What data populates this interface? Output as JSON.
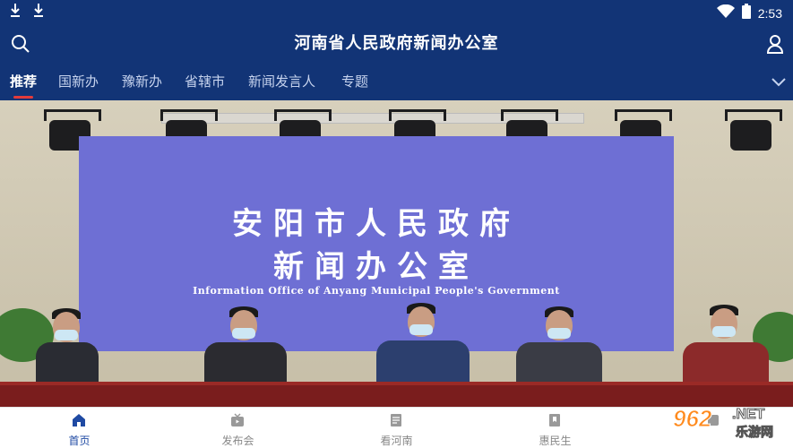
{
  "status_bar": {
    "time": "2:53",
    "icons": [
      "download-icon",
      "download-icon",
      "wifi-icon",
      "battery-icon"
    ]
  },
  "header": {
    "title": "河南省人民政府新闻办公室",
    "left_icon": "search-icon",
    "right_icon": "user-icon"
  },
  "tabs": [
    {
      "label": "推荐",
      "active": true
    },
    {
      "label": "国新办",
      "active": false
    },
    {
      "label": "豫新办",
      "active": false
    },
    {
      "label": "省辖市",
      "active": false
    },
    {
      "label": "新闻发言人",
      "active": false
    },
    {
      "label": "专题",
      "active": false
    }
  ],
  "hero": {
    "backdrop_line1": "安阳市人民政府",
    "backdrop_line2": "新闻办公室",
    "backdrop_en": "Information Office of Anyang Municipal People's Government"
  },
  "bottom_nav": [
    {
      "label": "首页",
      "icon": "home-icon",
      "active": true
    },
    {
      "label": "发布会",
      "icon": "tv-icon",
      "active": false
    },
    {
      "label": "看河南",
      "icon": "news-icon",
      "active": false
    },
    {
      "label": "惠民生",
      "icon": "bookmark-icon",
      "active": false
    },
    {
      "label": "",
      "icon": "more-icon",
      "active": false
    }
  ],
  "watermark": {
    "number": "962",
    "net": ".NET",
    "text": "乐游网"
  },
  "colors": {
    "primary": "#123476",
    "tab_indicator": "#e33b3b",
    "nav_active": "#1f4aa3",
    "backdrop": "#6e6fd4"
  }
}
